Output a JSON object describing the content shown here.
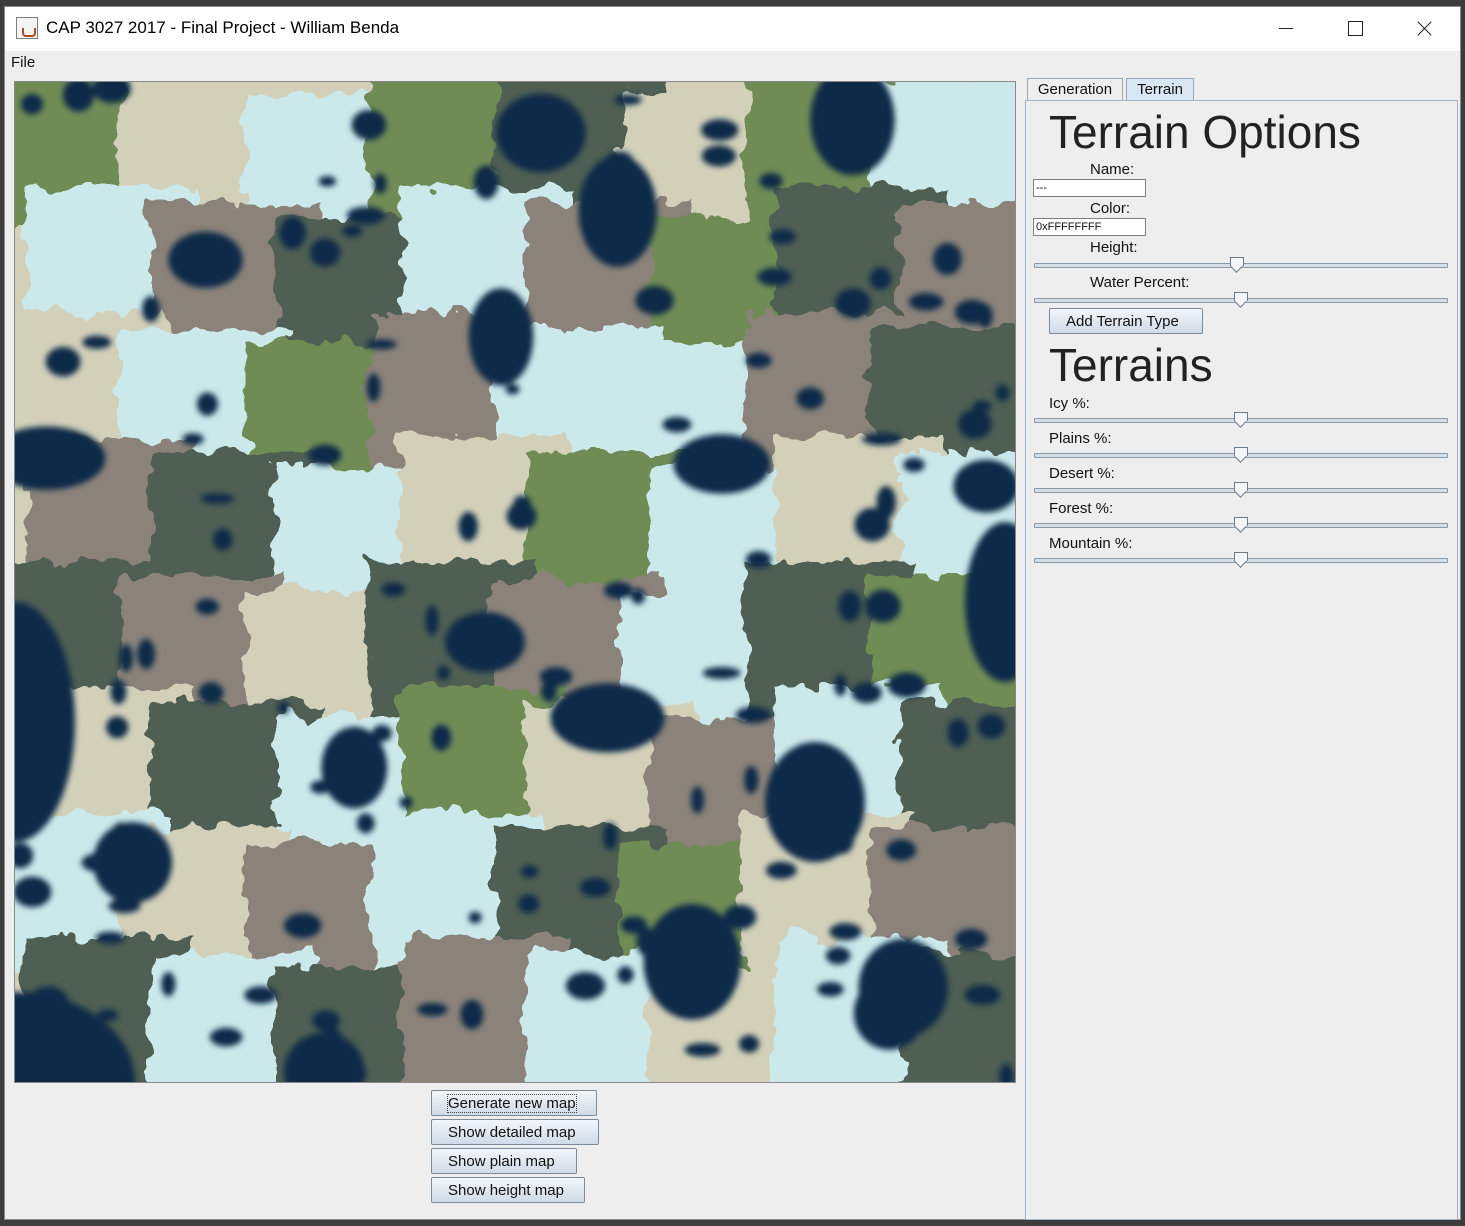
{
  "window": {
    "title": "CAP 3027 2017 - Final Project - William Benda",
    "controls": [
      "minimize-icon",
      "maximize-icon",
      "close-icon"
    ]
  },
  "menu": {
    "file": "File"
  },
  "tabs": {
    "generation": "Generation",
    "terrain": "Terrain",
    "selected": "Terrain"
  },
  "terrain_options": {
    "heading": "Terrain Options",
    "name_label": "Name:",
    "name_value": "---",
    "color_label": "Color:",
    "color_value": "0xFFFFFFFF",
    "height_label": "Height:",
    "height_value": 0.49,
    "water_label": "Water Percent:",
    "water_value": 0.5,
    "add_button": "Add Terrain Type"
  },
  "terrains": {
    "heading": "Terrains",
    "items": [
      {
        "label": "Icy %:",
        "value": 0.5
      },
      {
        "label": "Plains %:",
        "value": 0.5
      },
      {
        "label": "Desert %:",
        "value": 0.5
      },
      {
        "label": "Forest %:",
        "value": 0.5
      },
      {
        "label": "Mountain %:",
        "value": 0.5
      }
    ]
  },
  "actions": {
    "generate": "Generate new map",
    "detailed": "Show detailed map",
    "plain": "Show plain map",
    "height": "Show height map"
  },
  "map_colors": {
    "water": "#0d2b4a",
    "icy": "#cbe8ea",
    "plains": "#6f8c55",
    "desert": "#d2d0b8",
    "forest": "#4f5e52",
    "mountain": "#8b8379"
  }
}
